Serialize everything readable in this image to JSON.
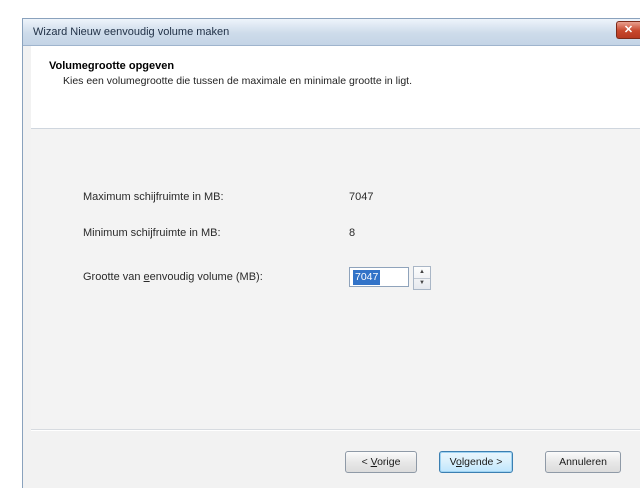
{
  "window": {
    "title": "Wizard Nieuw eenvoudig volume maken",
    "close_label": "✕"
  },
  "header": {
    "title": "Volumegrootte opgeven",
    "subtitle": "Kies een volumegrootte die tussen de maximale en minimale grootte in ligt."
  },
  "form": {
    "max_label": "Maximum schijfruimte in MB:",
    "max_value": "7047",
    "min_label": "Minimum schijfruimte in MB:",
    "min_value": "8",
    "size_label_pre": "Grootte van ",
    "size_label_accel": "e",
    "size_label_post": "envoudig volume (MB):",
    "size_value": "7047"
  },
  "buttons": {
    "back_pre": "< ",
    "back_accel": "V",
    "back_post": "orige",
    "next_pre": "V",
    "next_accel": "o",
    "next_post": "lgende >",
    "cancel": "Annuleren"
  }
}
